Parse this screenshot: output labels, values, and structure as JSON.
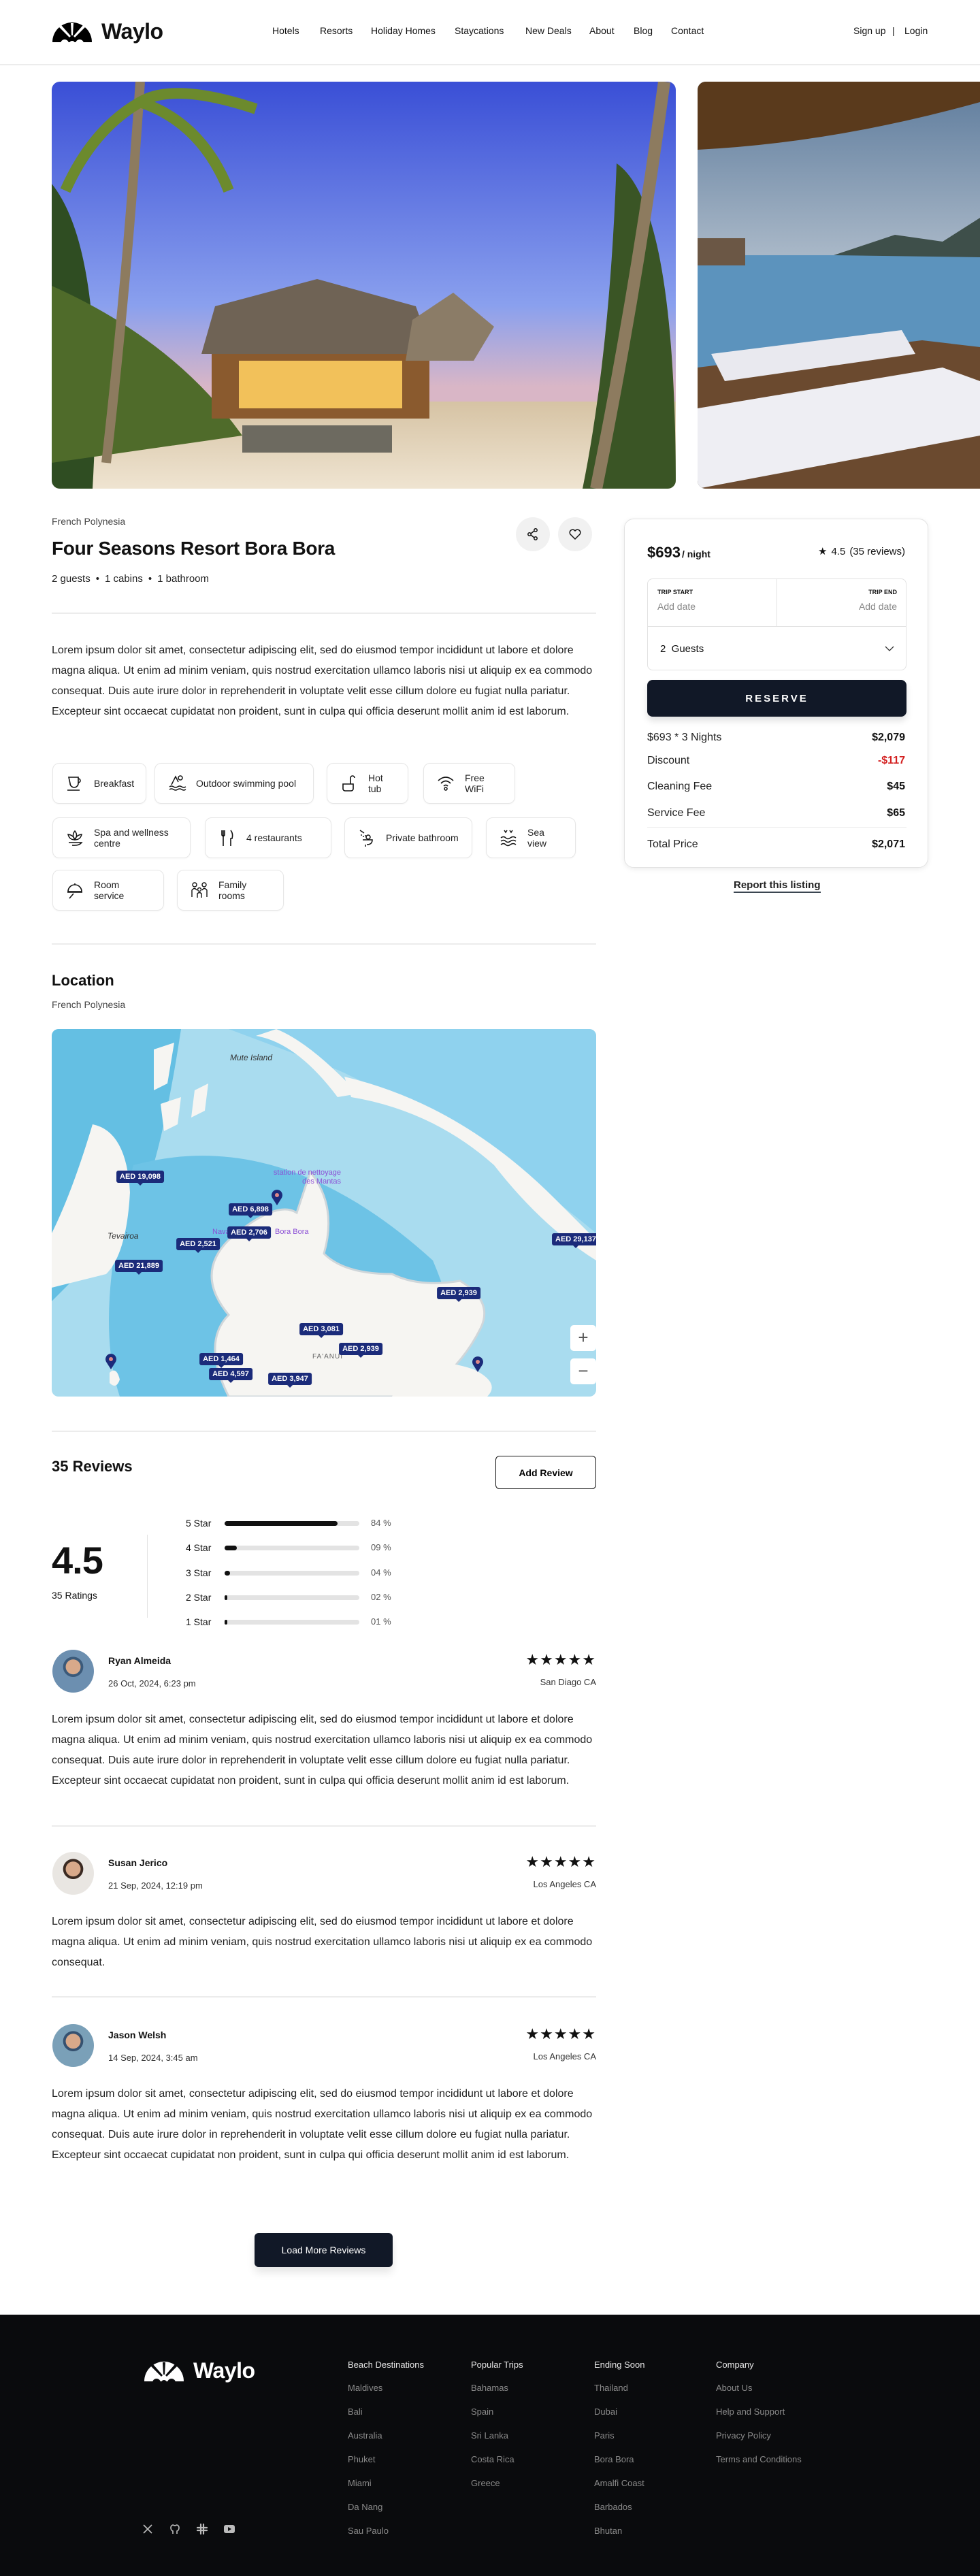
{
  "brand": {
    "name": "Waylo"
  },
  "nav": {
    "links": [
      "Hotels",
      "Resorts",
      "Holiday Homes",
      "Staycations",
      "New Deals",
      "About",
      "Blog",
      "Contact"
    ],
    "signup": "Sign up",
    "separator": "|",
    "login": "Login"
  },
  "listing": {
    "region": "French Polynesia",
    "title": "Four Seasons Resort Bora Bora",
    "meta": [
      "2 guests",
      "1 cabins",
      "1 bathroom"
    ],
    "meta_sep": "•",
    "description": "Lorem ipsum dolor sit amet, consectetur adipiscing elit, sed do eiusmod tempor incididunt ut labore et dolore magna aliqua. Ut enim ad minim veniam, quis nostrud exercitation ullamco laboris nisi ut aliquip ex ea commodo consequat. Duis aute irure dolor in reprehenderit in voluptate velit esse cillum dolore eu fugiat nulla pariatur. Excepteur sint occaecat cupidatat non proident, sunt in culpa qui officia deserunt mollit anim id est laborum.",
    "amenities": [
      {
        "label": "Breakfast",
        "icon": "coffee-cup-icon"
      },
      {
        "label": "Outdoor swimming pool",
        "icon": "swimmer-icon"
      },
      {
        "label": "Hot tub",
        "icon": "hot-tub-icon"
      },
      {
        "label": "Free WiFi",
        "icon": "wifi-icon"
      },
      {
        "label": "Spa and wellness centre",
        "icon": "lotus-icon"
      },
      {
        "label": "4 restaurants",
        "icon": "fork-knife-icon"
      },
      {
        "label": "Private bathroom",
        "icon": "shower-icon"
      },
      {
        "label": "Sea view",
        "icon": "waves-icon"
      },
      {
        "label": "Room service",
        "icon": "cloche-icon"
      },
      {
        "label": "Family rooms",
        "icon": "family-icon"
      }
    ]
  },
  "booking": {
    "price": "$693",
    "per": "/ night",
    "rating": "4.5",
    "reviews": "(35 reviews)",
    "trip_start_label": "TRIP START",
    "trip_end_label": "TRIP END",
    "date_placeholder": "Add date",
    "guests": "2  Guests",
    "reserve": "RESERVE",
    "lines": [
      {
        "label": "$693 * 3 Nights",
        "value": "$2,079"
      },
      {
        "label": "Discount",
        "value": "-$117"
      },
      {
        "label": "Cleaning Fee",
        "value": "$45"
      },
      {
        "label": "Service Fee",
        "value": "$65"
      }
    ],
    "total_label": "Total Price",
    "total_value": "$2,071",
    "report": "Report this listing",
    "discount_color": "#d32020"
  },
  "location": {
    "title": "Location",
    "subtitle": "French Polynesia",
    "map_labels": {
      "mute": "Mute Island",
      "tevairoa": "Tevairoa",
      "station": "station de nettoyage des Mantas",
      "nava": "Nava",
      "bora": "Bora Bora",
      "faanui": "FA'ANUI"
    },
    "pins": [
      "AED 19,098",
      "AED 6,898",
      "AED 2,706",
      "AED 2,521",
      "AED 21,889",
      "AED 29,137",
      "AED 2,939",
      "AED 3,081",
      "AED 2,939",
      "AED 1,464",
      "AED 4,597",
      "AED 3,947"
    ],
    "zoom_in": "+",
    "zoom_out": "−"
  },
  "reviews": {
    "title": "35 Reviews",
    "add": "Add Review",
    "average": "4.5",
    "ratings_count": "35 Ratings",
    "breakdown": [
      {
        "label": "5 Star",
        "pct": 84,
        "text": "84 %"
      },
      {
        "label": "4 Star",
        "pct": 9,
        "text": "09 %"
      },
      {
        "label": "3 Star",
        "pct": 4,
        "text": "04 %"
      },
      {
        "label": "2 Star",
        "pct": 2,
        "text": "02 %"
      },
      {
        "label": "1 Star",
        "pct": 1,
        "text": "01 %"
      }
    ],
    "items": [
      {
        "name": "Ryan Almeida",
        "date": "26 Oct, 2024, 6:23 pm",
        "location": "San Diago CA",
        "stars": "★★★★★",
        "text": "Lorem ipsum dolor sit amet, consectetur adipiscing elit, sed do eiusmod tempor incididunt ut labore et dolore magna aliqua. Ut enim ad minim veniam, quis nostrud exercitation ullamco laboris nisi ut aliquip ex ea commodo consequat. Duis aute irure dolor in reprehenderit in voluptate velit esse cillum dolore eu fugiat nulla pariatur. Excepteur sint occaecat cupidatat non proident, sunt in culpa qui officia deserunt mollit anim id est laborum."
      },
      {
        "name": "Susan Jerico",
        "date": "21 Sep, 2024, 12:19 pm",
        "location": "Los Angeles CA",
        "stars": "★★★★★",
        "text": "Lorem ipsum dolor sit amet, consectetur adipiscing elit, sed do eiusmod tempor incididunt ut labore et dolore magna aliqua. Ut enim ad minim veniam, quis nostrud exercitation ullamco laboris nisi ut aliquip ex ea commodo consequat."
      },
      {
        "name": "Jason Welsh",
        "date": "14 Sep, 2024, 3:45 am",
        "location": "Los Angeles CA",
        "stars": "★★★★★",
        "text": "Lorem ipsum dolor sit amet, consectetur adipiscing elit, sed do eiusmod tempor incididunt ut labore et dolore magna aliqua. Ut enim ad minim veniam, quis nostrud exercitation ullamco laboris nisi ut aliquip ex ea commodo consequat. Duis aute irure dolor in reprehenderit in voluptate velit esse cillum dolore eu fugiat nulla pariatur. Excepteur sint occaecat cupidatat non proident, sunt in culpa qui officia deserunt mollit anim id est laborum."
      }
    ],
    "load_more": "Load More Reviews"
  },
  "footer": {
    "columns": [
      {
        "title": "Beach Destinations",
        "items": [
          "Maldives",
          "Bali",
          "Australia",
          "Phuket",
          "Miami",
          "Da Nang",
          "Sau Paulo"
        ]
      },
      {
        "title": "Popular Trips",
        "items": [
          "Bahamas",
          "Spain",
          "Sri Lanka",
          "Costa Rica",
          "Greece"
        ]
      },
      {
        "title": "Ending Soon",
        "items": [
          "Thailand",
          "Dubai",
          "Paris",
          "Bora Bora",
          "Amalfi Coast",
          "Barbados",
          "Bhutan"
        ]
      },
      {
        "title": "Company",
        "items": [
          "About Us",
          "Help and Support",
          "Privacy Policy",
          "Terms and Conditions"
        ]
      }
    ],
    "social": [
      "x-icon",
      "github-icon",
      "slack-icon",
      "youtube-icon"
    ]
  }
}
